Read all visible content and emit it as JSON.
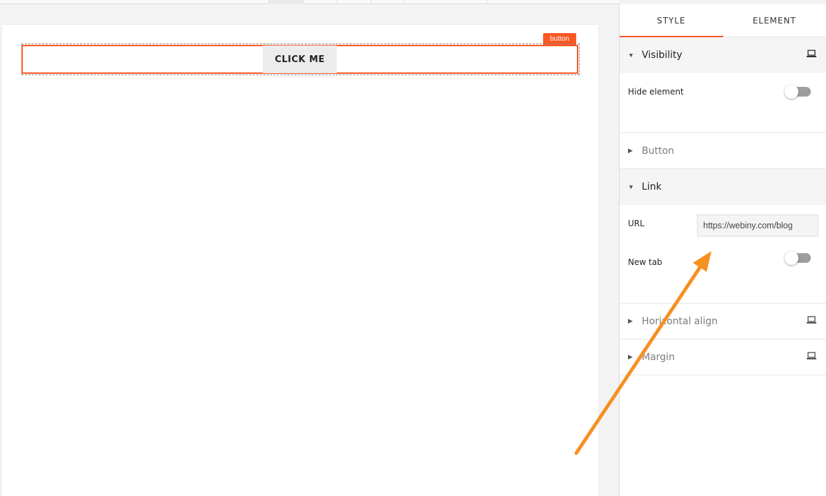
{
  "canvas": {
    "element_tag": "button",
    "button_label": "CLICK ME"
  },
  "panel": {
    "tabs": [
      {
        "label": "STYLE",
        "active": true
      },
      {
        "label": "ELEMENT",
        "active": false
      }
    ],
    "sections": {
      "visibility": {
        "title": "Visibility",
        "hide_element_label": "Hide element",
        "hide_element_on": false
      },
      "button": {
        "title": "Button"
      },
      "link": {
        "title": "Link",
        "url_label": "URL",
        "url_value": "https://webiny.com/blog",
        "new_tab_label": "New tab",
        "new_tab_on": false
      },
      "horizontal_align": {
        "title": "Horizontal align"
      },
      "margin": {
        "title": "Margin"
      }
    }
  },
  "colors": {
    "accent": "#fa5723",
    "arrow": "#f7901e",
    "toggle_off": "#9e9e9e"
  },
  "icons": {
    "expanded": "caret-down-icon",
    "collapsed": "caret-right-icon",
    "device": "laptop-icon"
  }
}
